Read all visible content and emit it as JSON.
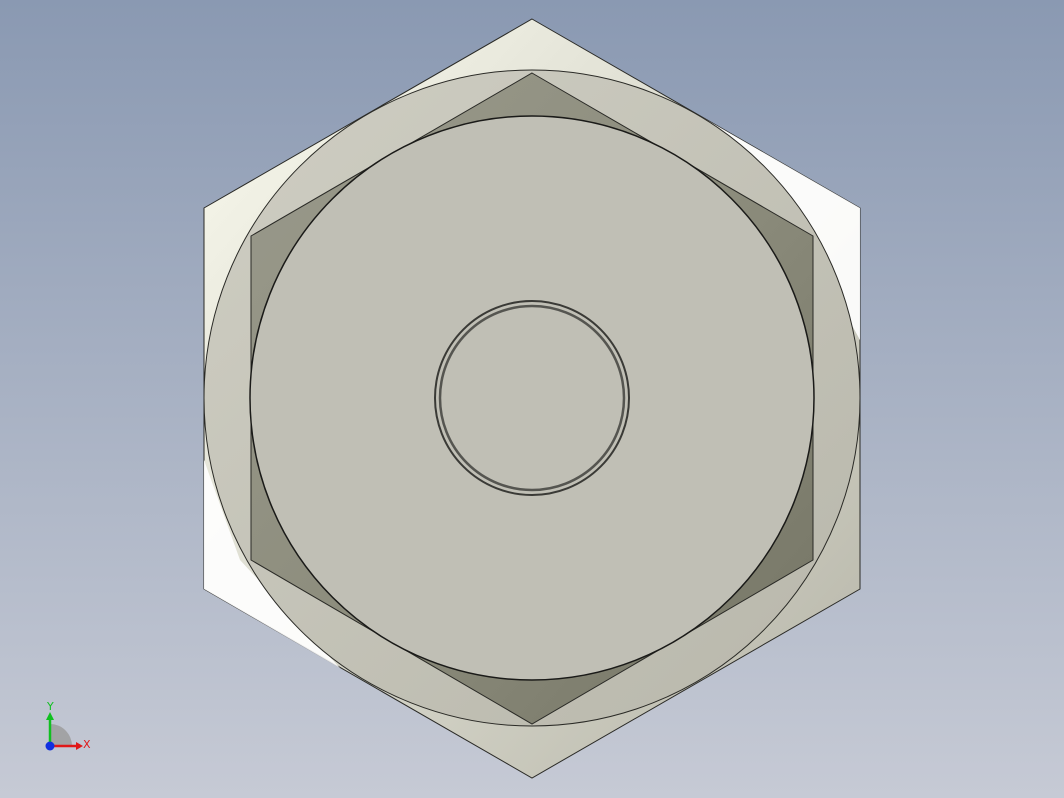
{
  "viewport": {
    "background_top": "#8a99b2",
    "background_bottom": "#c6cad5"
  },
  "part": {
    "shape": "hex-nut-bottom-view",
    "colors": {
      "outer_hex_light": "#fbfbf2",
      "outer_hex_bright": "#ffffff",
      "washer_face": "#c3c2b7",
      "bearing_face": "#c0bfb5",
      "chamfer_dark": "#858574",
      "chamfer_mid": "#a5a59a",
      "edge": "#2a2a26"
    }
  },
  "triad": {
    "x_label": "X",
    "y_label": "Y",
    "x_color": "#e01818",
    "y_color": "#10c020",
    "z_color": "#1030e0"
  }
}
